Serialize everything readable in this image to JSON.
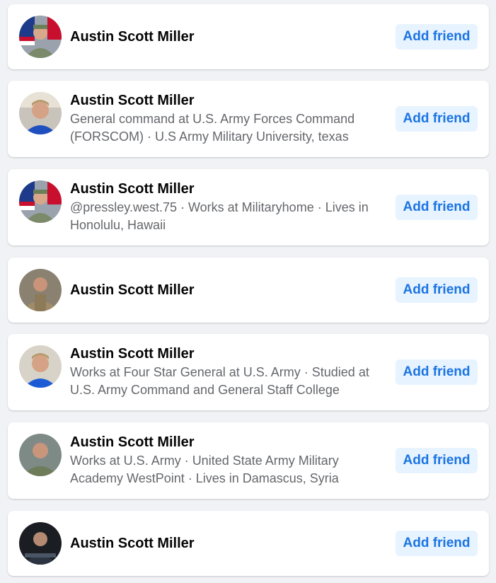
{
  "colors": {
    "page_bg": "#f0f2f5",
    "card_bg": "#ffffff",
    "name_text": "#050505",
    "subtitle_text": "#65676b",
    "button_bg": "#e7f3ff",
    "button_text": "#1b74e4"
  },
  "results": [
    {
      "name": "Austin Scott Miller",
      "subtitle": "",
      "button_label": "Add friend"
    },
    {
      "name": "Austin Scott Miller",
      "subtitle": "General command at U.S. Army Forces Command (FORSCOM) · U.S Army Military University, texas",
      "button_label": "Add friend"
    },
    {
      "name": "Austin Scott Miller",
      "subtitle": "@pressley.west.75 · Works at Militaryhome · Lives in Honolulu, Hawaii",
      "button_label": "Add friend"
    },
    {
      "name": "Austin Scott Miller",
      "subtitle": "",
      "button_label": "Add friend"
    },
    {
      "name": "Austin Scott Miller",
      "subtitle": "Works at Four Star General at U.S. Army · Studied at U.S. Army Command and General Staff College",
      "button_label": "Add friend"
    },
    {
      "name": "Austin Scott Miller",
      "subtitle": "Works at U.S. Army · United State Army Military Academy WestPoint · Lives in Damascus, Syria",
      "button_label": "Add friend"
    },
    {
      "name": "Austin Scott Miller",
      "subtitle": "",
      "button_label": "Add friend"
    }
  ]
}
